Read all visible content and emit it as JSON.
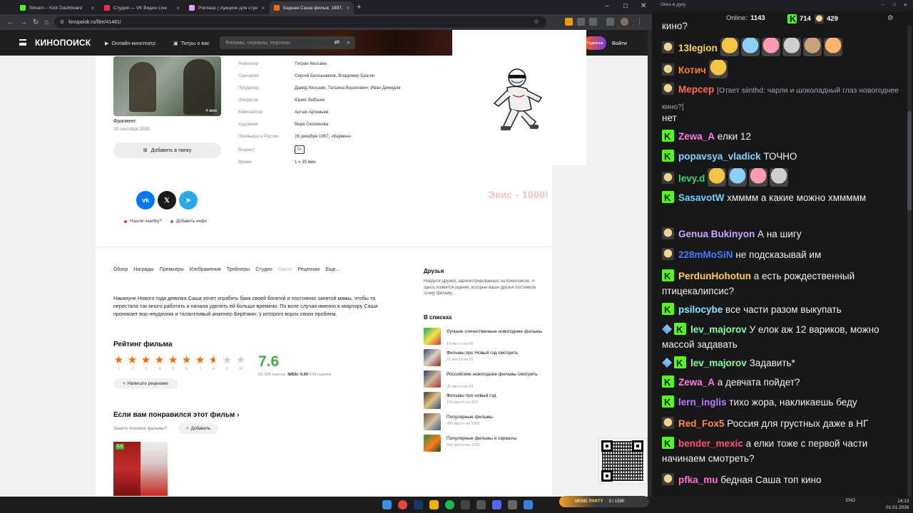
{
  "browser": {
    "tabs": [
      {
        "label": "Stream – Kick Dashboard",
        "color": "#53fc18"
      },
      {
        "label": "Студия — VK Видео Live",
        "color": "#ff2a55"
      },
      {
        "label": "Pointauc | Аукцион для стрим…",
        "color": "#e2a6ff"
      },
      {
        "label": "Бедная Саша фильм, 1997, д…",
        "color": "#ff6a00"
      }
    ],
    "url": "kinopoisk.ru/film/41481/"
  },
  "kp": {
    "logo": "КИНОПОИСК",
    "nav_online": "Онлайн-кинотеатр",
    "nav_credits": "Титры о вас",
    "search_placeholder": "Фильмы, сериалы, персоны",
    "subscribe": "Подписка",
    "login": "Войти",
    "trailer": {
      "duration": "4 мин",
      "title": "Фрагмент",
      "date": "18 сентября 2009"
    },
    "add_folder": "Добавить в папку",
    "credits": [
      {
        "k": "Режиссер",
        "v": "Тигран Кеосаян"
      },
      {
        "k": "Сценарий",
        "v": "Сергей Белошников, Владимир Брагин"
      },
      {
        "k": "Продюсер",
        "v": "Давид Кеосаян, Татьяна Воронович, Иван Демидов"
      },
      {
        "k": "Оператор",
        "v": "Юрий Любшин"
      },
      {
        "k": "Композитор",
        "v": "Артем Артемьев"
      },
      {
        "k": "Художник",
        "v": "Вера Скопинова"
      },
      {
        "k": "Премьера в России",
        "v": "26 декабря 1997, «Кармен»"
      },
      {
        "k": "Возраст",
        "v": ""
      },
      {
        "k": "Время",
        "v": "1 ч 35 мин"
      }
    ],
    "age_rating": "0+",
    "report_error": "Нашли ошибку?",
    "add_info": "Добавить инфо",
    "overlay_text": "Экис - 1000!",
    "tabs": [
      "Обзор",
      "Награды",
      "Премьеры",
      "Изображения",
      "Трейлеры",
      "Студии",
      "Связи",
      "Рецензии",
      "Еще..."
    ],
    "description": "Накануне Нового года девочка Саша хочет ограбить банк своей богатой и постоянно занятой мамы, чтобы та перестала так много работать и начала уделять ей больше времени. По воле случая именно в квартиру Саши проникает вор-неудачник и талантливый инженер Берёзкин, у которого ворох своих проблем.",
    "rating_title": "Рейтинг фильма",
    "rating_value": "7.6",
    "rating_numeric": 7.6,
    "votes": "33 335 оценок",
    "imdb_label": "IMDb: 6.60",
    "imdb_votes": "634 оценки",
    "star_numbers": [
      "1",
      "2",
      "3",
      "4",
      "5",
      "6",
      "7",
      "8",
      "9",
      "10"
    ],
    "write_review": "Написать рецензию",
    "similar_title": "Если вам понравился этот фильм",
    "similar_q": "Знаете похожие фильмы?",
    "similar_add": "Добавить",
    "poster_rating": "6.8",
    "friends_title": "Друзья",
    "friends_desc": "Найдите друзей, зарегистрированных на Кинопоиске, и здесь появятся оценки, которые ваши друзья поставили этому фильму...",
    "lists_title": "В списках",
    "lists": [
      {
        "name": "Лучшие отечественные новогодние фильмы",
        "place": "13 место из 50"
      },
      {
        "name": "Фильмы про Новый год смотреть",
        "place": "31 место из 31"
      },
      {
        "name": "Российские новогодние фильмы смотреть",
        "place": "26 место из 32"
      },
      {
        "name": "Фильмы про новый год",
        "place": "103 место из 293"
      },
      {
        "name": "Популярные фильмы",
        "place": "380 место из 1000"
      },
      {
        "name": "Популярные фильмы и сериалы",
        "place": "543 место из 1000"
      }
    ]
  },
  "chat": {
    "window_title": "Окно в дуку",
    "online_label": "Online:",
    "online_count": "1143",
    "kick_count": "714",
    "other_count": "429",
    "messages": [
      {
        "user": "",
        "color": "#efeff1",
        "text": "кино?",
        "badge": ""
      },
      {
        "user": "13legion",
        "color": "#f5d442",
        "text": "",
        "badge": "f",
        "emotes": 6
      },
      {
        "user": "Котич",
        "color": "#ff7f26",
        "text": "",
        "badge": "f",
        "emotes": 1
      },
      {
        "user": "Мерсер",
        "color": "#ff6b4a",
        "reply": "[Ответ siinthd: чарли и шоколадный глаз новогоднее кино?]",
        "text": "",
        "badge": "f"
      },
      {
        "user": "",
        "color": "#efeff1",
        "text": "нет",
        "badge": ""
      },
      {
        "user": "Zewa_A",
        "color": "#ff7ad9",
        "text": "елки 12",
        "badge": "k"
      },
      {
        "user": "popavsya_vladick",
        "color": "#7fd3ff",
        "text": "ТОЧНО",
        "badge": "k"
      },
      {
        "user": "levy.d",
        "color": "#2bd673",
        "text": "",
        "badge": "f",
        "emotes": 4
      },
      {
        "user": "SasavotW",
        "color": "#6ed2ff",
        "text": "хмммм а какие можно хммммм",
        "badge": "k"
      },
      {
        "user": "Genua Bukinyon",
        "color": "#c9a7ff",
        "text": "А на шигу",
        "badge": "f"
      },
      {
        "user": "228mMoSiN",
        "color": "#3f7bff",
        "text": "не подсказывай им",
        "badge": "f"
      },
      {
        "user": "PerdunHohotun",
        "color": "#ffcf4a",
        "text": "а есть рождественный птицекалипсис?",
        "badge": "k"
      },
      {
        "user": "psilocybe",
        "color": "#7ae8ff",
        "text": "все части разом выкупать",
        "badge": "k"
      },
      {
        "user": "lev_majorov",
        "color": "#7dff9a",
        "text": "У елок аж 12 вариков, можно массой задавать",
        "badge": "sk"
      },
      {
        "user": "lev_majorov",
        "color": "#7dff9a",
        "text": "Задавить*",
        "badge": "sk"
      },
      {
        "user": "Zewa_A",
        "color": "#ff7ad9",
        "text": "а девчата пойдет?",
        "badge": "k"
      },
      {
        "user": "lern_inglis",
        "color": "#b77aff",
        "text": "тихо жора, накликаешь беду",
        "badge": "k"
      },
      {
        "user": "Red_Fox5",
        "color": "#ff8a3a",
        "text": "Россия для грустных даже в НГ",
        "badge": "f"
      },
      {
        "user": "bender_mexic",
        "color": "#ff4f6e",
        "text": "а елки тоже с первой части начинаем смотреть?",
        "badge": "k"
      },
      {
        "user": "pfka_mu",
        "color": "#ff6fd0",
        "text": "бедная Саша топ кино",
        "badge": "f"
      }
    ]
  },
  "taskbar": {
    "tray_lang": "ENG",
    "time": "14:13",
    "date": "01.01.2026",
    "meme_party": "MEME PARTY",
    "meme_progress": "0 / 1590"
  }
}
